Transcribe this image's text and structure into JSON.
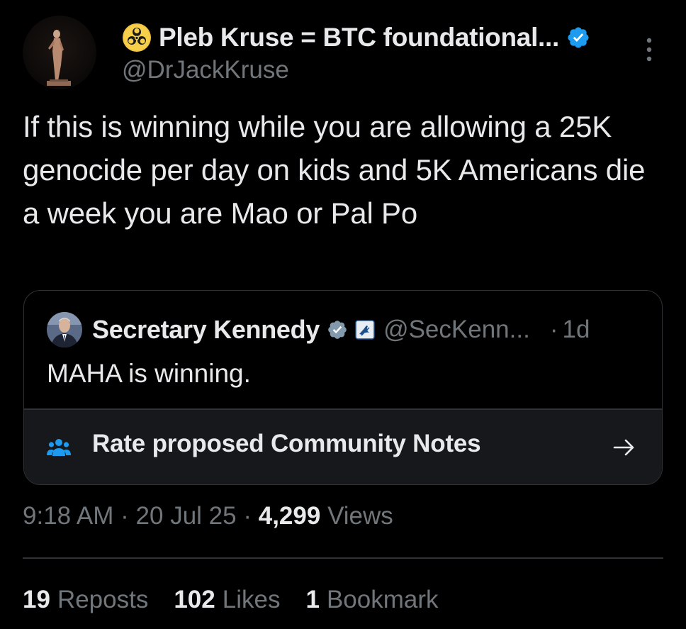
{
  "author": {
    "display_name": "Pleb Kruse = BTC foundational...",
    "handle": "@DrJackKruse",
    "avatar_icon": "statue-avatar",
    "name_icon": "biohazard-icon",
    "verified": true
  },
  "tweet": {
    "text": "If this is winning while you are allowing a 25K genocide per day on kids and 5K Americans die a week you are Mao or Pal Po"
  },
  "quote": {
    "display_name": "Secretary Kennedy",
    "handle": "@SecKenn...",
    "separator": "·",
    "time": "1d",
    "text": "MAHA is winning.",
    "verified": true,
    "gov_badge_icon": "hhs-eagle-icon"
  },
  "community_notes": {
    "label": "Rate proposed Community Notes",
    "icon": "people-icon",
    "arrow_icon": "arrow-right-icon"
  },
  "meta": {
    "time": "9:18 AM",
    "sep1": "·",
    "date": "20 Jul 25",
    "sep2": "·",
    "views_count": "4,299",
    "views_label": "Views"
  },
  "stats": {
    "reposts_count": "19",
    "reposts_label": "Reposts",
    "likes_count": "102",
    "likes_label": "Likes",
    "bookmarks_count": "1",
    "bookmarks_label": "Bookmark"
  },
  "colors": {
    "background": "#000000",
    "text": "#e7e9ea",
    "secondary": "#71767b",
    "border": "#2f3336",
    "verified_blue": "#1d9bf0",
    "notes_blue": "#1d9bf0"
  }
}
